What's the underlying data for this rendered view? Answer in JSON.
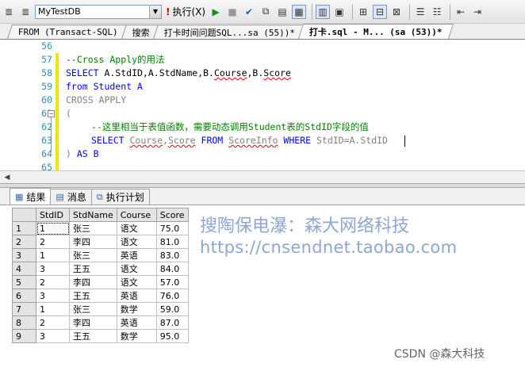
{
  "toolbar": {
    "database": "MyTestDB",
    "execute_label": "执行(X)"
  },
  "tabs": [
    {
      "label": "FROM (Transact-SQL)"
    },
    {
      "label": "搜索"
    },
    {
      "label": "打卡时间问题SQL...sa (55))*"
    },
    {
      "label": "打卡.sql - M... (sa (53))*"
    }
  ],
  "editor": {
    "lines": [
      {
        "num": "56"
      },
      {
        "num": "57"
      },
      {
        "num": "58"
      },
      {
        "num": "59"
      },
      {
        "num": "60"
      },
      {
        "num": "61"
      },
      {
        "num": "62"
      },
      {
        "num": "63"
      },
      {
        "num": "64"
      },
      {
        "num": "65"
      }
    ],
    "line57": "--Cross Apply的用法",
    "l58_select": "SELECT",
    "l58_a": " A.StdID,A.StdName,B.",
    "l58_course": "Course",
    "l58_comma": ",B.",
    "l58_score": "Score",
    "l59_from": "from",
    "l59_rest": " Student A",
    "l60": "CROSS APPLY",
    "l61": "(",
    "line62": "--这里相当于表值函数，需要动态调用Student表的StdID字段的值",
    "l63_select": "SELECT",
    "l63_course": "Course",
    "l63_comma": ",",
    "l63_score": "Score",
    "l63_from": "FROM",
    "l63_tbl": "ScoreInfo",
    "l63_where": "WHERE",
    "l63_cond": " StdID=A.StdID",
    "l64_paren": ") ",
    "l64_as": "AS",
    "l64_b": " B"
  },
  "results_tabs": [
    {
      "label": "结果"
    },
    {
      "label": "消息"
    },
    {
      "label": "执行计划"
    }
  ],
  "grid": {
    "columns": [
      "StdID",
      "StdName",
      "Course",
      "Score"
    ],
    "rows": [
      {
        "n": "1",
        "id": "1",
        "name": "张三",
        "course": "语文",
        "score": "75.0"
      },
      {
        "n": "2",
        "id": "2",
        "name": "李四",
        "course": "语文",
        "score": "81.0"
      },
      {
        "n": "3",
        "id": "1",
        "name": "张三",
        "course": "英语",
        "score": "83.0"
      },
      {
        "n": "4",
        "id": "3",
        "name": "王五",
        "course": "语文",
        "score": "84.0"
      },
      {
        "n": "5",
        "id": "2",
        "name": "李四",
        "course": "语文",
        "score": "57.0"
      },
      {
        "n": "6",
        "id": "3",
        "name": "王五",
        "course": "英语",
        "score": "76.0"
      },
      {
        "n": "7",
        "id": "1",
        "name": "张三",
        "course": "数学",
        "score": "59.0"
      },
      {
        "n": "8",
        "id": "2",
        "name": "李四",
        "course": "英语",
        "score": "87.0"
      },
      {
        "n": "9",
        "id": "3",
        "name": "王五",
        "course": "数学",
        "score": "95.0"
      }
    ]
  },
  "watermark": {
    "line1": "搜陶保电瀑：森大网络科技",
    "line2": "https://cnsendnet.taobao.com",
    "csdn": "CSDN @森大科技"
  }
}
